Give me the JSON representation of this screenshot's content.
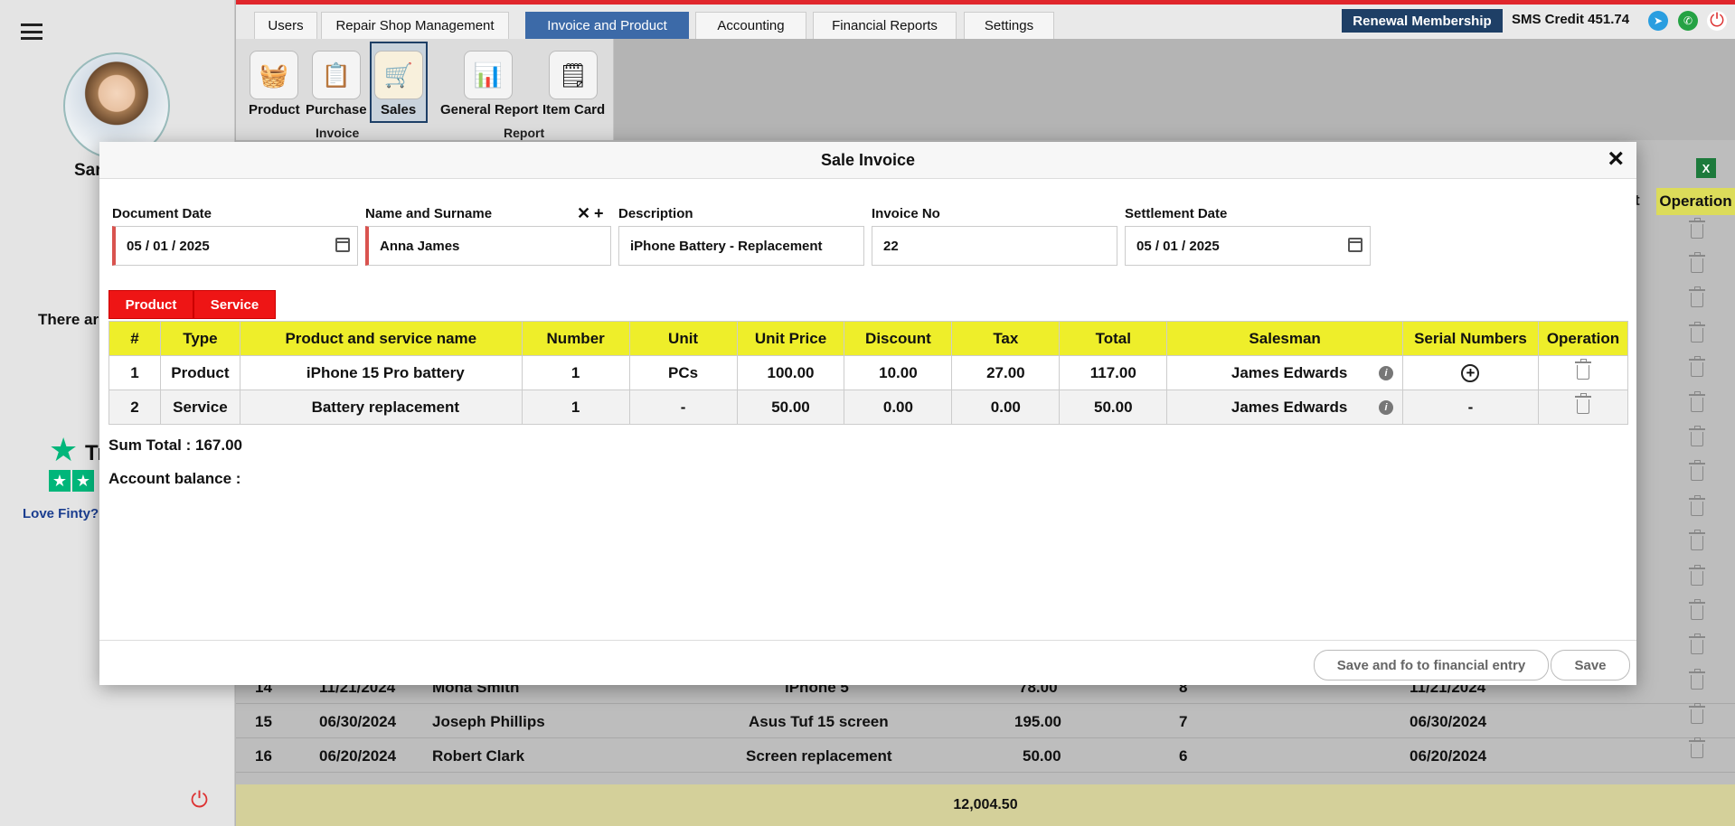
{
  "topnav": {
    "tabs": [
      "Users",
      "Repair Shop Management",
      "Invoice and Product",
      "Accounting",
      "Financial Reports",
      "Settings"
    ],
    "renewal": "Renewal Membership",
    "sms": "SMS Credit 451.74"
  },
  "ribbon": {
    "product": "Product",
    "purchase": "Purchase",
    "sales": "Sales",
    "general_report": "General Report",
    "item_card": "Item Card",
    "group_invoice": "Invoice",
    "group_report": "Report"
  },
  "sidebar": {
    "user_name": "Sar",
    "there": "There ar",
    "trustpilot_t": "Tr",
    "love": "Love Finty?"
  },
  "background": {
    "operation_header": "Operation",
    "header_partial": "t",
    "rows": [
      {
        "no": "14",
        "date": "11/21/2024",
        "name": "Mona Smith",
        "item": "iPhone 5",
        "amount": "78.00",
        "qty": "8",
        "date2": "11/21/2024"
      },
      {
        "no": "15",
        "date": "06/30/2024",
        "name": "Joseph Phillips",
        "item": "Asus Tuf 15 screen",
        "amount": "195.00",
        "qty": "7",
        "date2": "06/30/2024"
      },
      {
        "no": "16",
        "date": "06/20/2024",
        "name": "Robert Clark",
        "item": "Screen replacement",
        "amount": "50.00",
        "qty": "6",
        "date2": "06/20/2024"
      }
    ],
    "footer_total": "12,004.50"
  },
  "modal": {
    "title": "Sale Invoice",
    "fields": {
      "document_date_label": "Document Date",
      "document_date": "05 / 01 / 2025",
      "name_label": "Name and Surname",
      "name": "Anna James",
      "description_label": "Description",
      "description": "iPhone Battery - Replacement",
      "invoice_no_label": "Invoice No",
      "invoice_no": "22",
      "settlement_label": "Settlement Date",
      "settlement_date": "05 / 01 / 2025"
    },
    "add_product": "Product",
    "add_service": "Service",
    "columns": [
      "#",
      "Type",
      "Product and service name",
      "Number",
      "Unit",
      "Unit Price",
      "Discount",
      "Tax",
      "Total",
      "Salesman",
      "Serial Numbers",
      "Operation"
    ],
    "rows": [
      {
        "no": "1",
        "type": "Product",
        "name": "iPhone 15 Pro battery",
        "number": "1",
        "unit": "PCs",
        "unit_price": "100.00",
        "discount": "10.00",
        "tax": "27.00",
        "total": "117.00",
        "salesman": "James Edwards",
        "serial": "+"
      },
      {
        "no": "2",
        "type": "Service",
        "name": "Battery replacement",
        "number": "1",
        "unit": "-",
        "unit_price": "50.00",
        "discount": "0.00",
        "tax": "0.00",
        "total": "50.00",
        "salesman": "James Edwards",
        "serial": "-"
      }
    ],
    "sum_total": "Sum Total : 167.00",
    "account_balance": "Account balance :",
    "save_financial": "Save and fo to financial entry",
    "save": "Save"
  }
}
